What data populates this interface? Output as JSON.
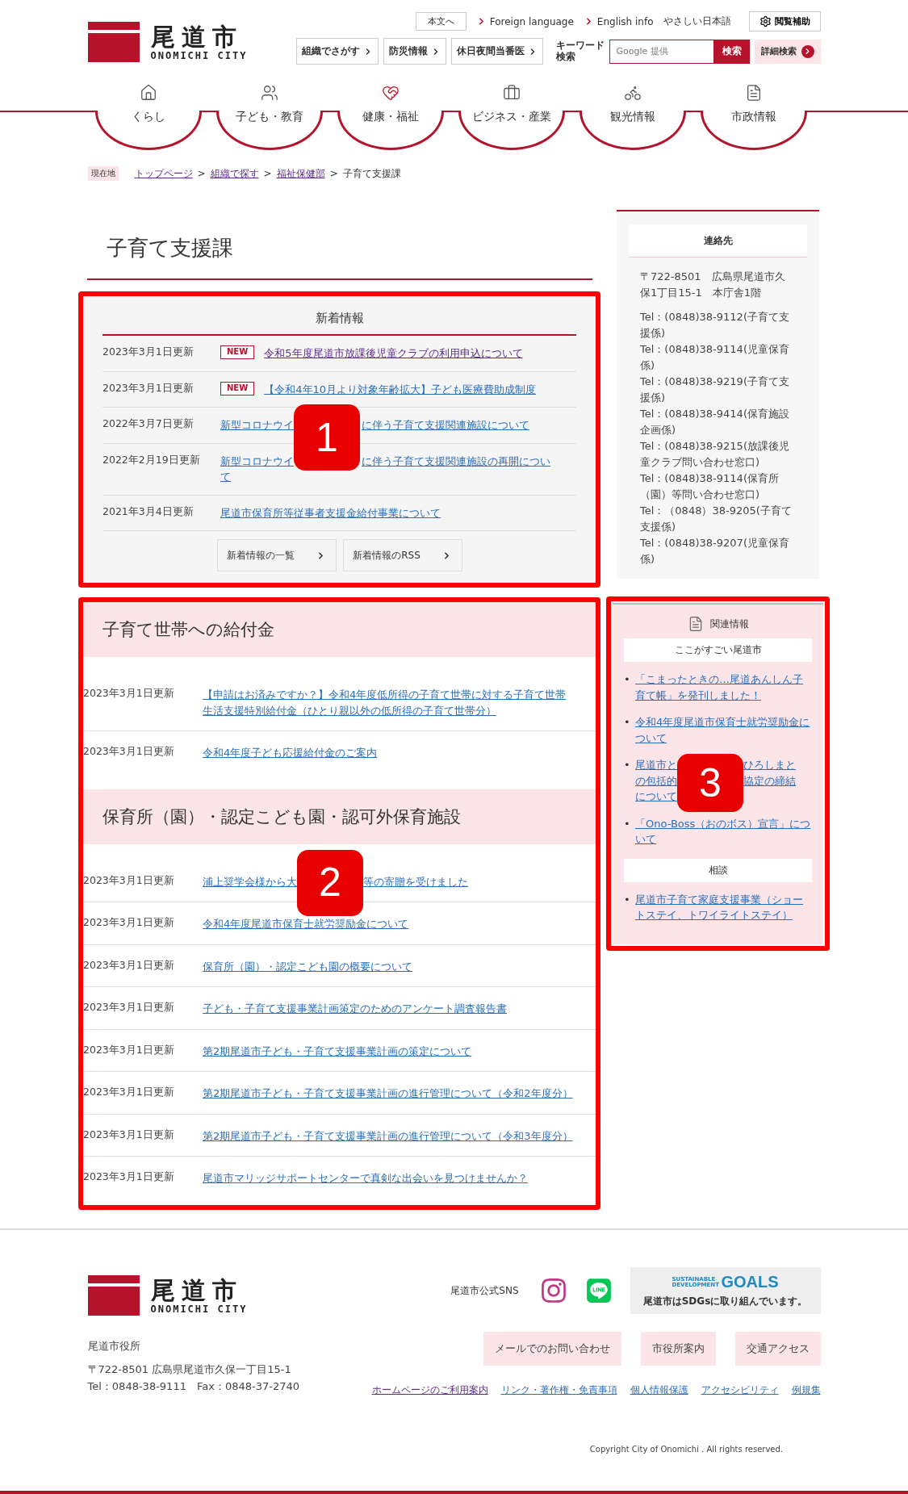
{
  "header": {
    "logo": {
      "name": "尾道市",
      "roman": "ONOMICHI CITY"
    },
    "top_links": [
      {
        "label": "本文へ",
        "kind": "boxed"
      },
      {
        "label": "Foreign language",
        "kind": "arrow"
      },
      {
        "label": "English info",
        "kind": "arrow"
      },
      {
        "label": "やさしい日本語",
        "kind": "plain"
      }
    ],
    "assist_button": "閲覧補助",
    "quick_buttons": [
      "組織でさがす",
      "防災情報",
      "休日夜間当番医"
    ],
    "search": {
      "label": "キーワード検索",
      "placeholder": "Google 提供",
      "button": "検索"
    },
    "advanced_search": "詳細検索"
  },
  "nav": [
    {
      "label": "くらし"
    },
    {
      "label": "子ども・教育"
    },
    {
      "label": "健康・福祉"
    },
    {
      "label": "ビジネス・産業"
    },
    {
      "label": "観光情報"
    },
    {
      "label": "市政情報"
    }
  ],
  "breadcrumb": {
    "tag": "現在地",
    "separator": ">",
    "items": [
      {
        "label": "トップページ",
        "kind": "link",
        "visited": true
      },
      {
        "label": "組織で探す",
        "kind": "link",
        "visited": true
      },
      {
        "label": "福祉保健部",
        "kind": "link",
        "visited": true
      },
      {
        "label": "子育て支援課",
        "kind": "current"
      }
    ]
  },
  "page_title": "子育て支援課",
  "news": {
    "title": "新着情報",
    "rows": [
      {
        "date": "2023年3月1日更新",
        "badge": "NEW",
        "link": {
          "text": "令和5年度尾道市放課後児童クラブの利用申込について",
          "visited": true
        }
      },
      {
        "date": "2023年3月1日更新",
        "badge": "NEW",
        "link": {
          "text": "【令和4年10月より対象年齢拡大】子ども医療費助成制度",
          "visited": false
        }
      },
      {
        "date": "2022年3月7日更新",
        "link": {
          "lines": [
            [
              "新型コロナウイ",
              "に伴う子育て支援関連施設について"
            ]
          ],
          "visited": false
        }
      },
      {
        "date": "2022年2月19日更新",
        "link": {
          "lines": [
            [
              "新型コロナウイ",
              "に伴う子育て支援関連施設の再開につい"
            ],
            [
              "て"
            ]
          ],
          "visited": false
        }
      },
      {
        "date": "2021年3月4日更新",
        "link": {
          "text": "尾道市保育所等従事者支援金給付事業について",
          "visited": false
        }
      }
    ],
    "buttons": [
      "新着情報の一覧",
      "新着情報のRSS"
    ]
  },
  "sections": [
    {
      "heading": "子育て世帯への給付金",
      "rows": [
        {
          "date": "2023年3月1日更新",
          "link": {
            "lines": [
              [
                "【申請はお済みですか？】令和4年度低所得の子育て世帯に対する子育て世帯"
              ],
              [
                "生活支援特別給付金（ひとり親以外の低所得の子育て世帯分）"
              ]
            ]
          }
        },
        {
          "date": "2023年3月1日更新",
          "link": {
            "text": "令和4年度子ども応援給付金のご案内"
          }
        }
      ]
    },
    {
      "heading": "保育所（園）・認定こども園・認可外保育施設",
      "rows": [
        {
          "date": "2023年3月1日更新",
          "link": {
            "lines": [
              [
                "浦上奨学会様から大",
                "等の寄贈を受けました"
              ]
            ]
          }
        },
        {
          "date": "2023年3月1日更新",
          "link": {
            "text": "令和4年度尾道市保育士就労奨励金について"
          }
        },
        {
          "date": "2023年3月1日更新",
          "link": {
            "text": "保育所（園）・認定こども園の概要について"
          }
        },
        {
          "date": "2023年3月1日更新",
          "link": {
            "text": "子ども・子育て支援事業計画策定のためのアンケート調査報告書"
          }
        },
        {
          "date": "2023年3月1日更新",
          "link": {
            "text": "第2期尾道市子ども・子育て支援事業計画の策定について"
          }
        },
        {
          "date": "2023年3月1日更新",
          "link": {
            "text": "第2期尾道市子ども・子育て支援事業計画の進行管理について（令和2年度分）"
          }
        },
        {
          "date": "2023年3月1日更新",
          "link": {
            "text": "第2期尾道市子ども・子育て支援事業計画の進行管理について（令和3年度分）"
          }
        },
        {
          "date": "2023年3月1日更新",
          "link": {
            "text": "尾道市マリッジサポートセンターで真剣な出会いを見つけませんか？"
          }
        }
      ]
    }
  ],
  "contact": {
    "title": "連絡先",
    "address": "〒722-8501　広島県尾道市久保1丁目15-1　本庁舎1階",
    "phones": [
      "Tel：(0848)38-9112(子育て支援係)",
      "Tel：(0848)38-9114(児童保育係)",
      "Tel：(0848)38-9219(子育て支援係)",
      "Tel：(0848)38-9414(保育施設企画係)",
      "Tel：(0848)38-9215(放課後児童クラブ問い合わせ窓口)",
      "Tel：(0848)38-9114(保育所（園）等問い合わせ窓口)",
      "Tel：（0848）38-9205(子育て支援係)",
      "Tel：(0848)38-9207(児童保育係)"
    ]
  },
  "related": {
    "title": "関連情報",
    "marker": "•",
    "groups": [
      {
        "heading": "ここがすごい尾道市",
        "links": [
          {
            "text": "「こまったときの…尾道あんしん子育て帳」を発刊しました！"
          },
          {
            "text": "令和4年度尾道市保育士就労奨励金について"
          },
          {
            "lines": [
              [
                "尾道市と",
                "ひろしまと"
              ],
              [
                "の包括的",
                "協定の締結"
              ],
              [
                "について"
              ]
            ]
          },
          {
            "text": "「Ono-Boss（おのボス）宣言」について"
          }
        ]
      },
      {
        "heading": "相談",
        "links": [
          {
            "text": "尾道市子育て家庭支援事業（ショートステイ、トワイライトステイ）"
          }
        ]
      }
    ]
  },
  "annotations": [
    {
      "label": "1"
    },
    {
      "label": "2"
    },
    {
      "label": "3"
    }
  ],
  "footer": {
    "logo": {
      "name": "尾道市",
      "roman": "ONOMICHI CITY"
    },
    "office": "尾道市役所",
    "address": "〒722-8501 広島県尾道市久保一丁目15-1",
    "tel": "Tel：0848-38-9111　Fax：0848-37-2740",
    "sns_label": "尾道市公式SNS",
    "sdgs": {
      "title_top": "SUSTAINABLE",
      "title_bottom": "DEVELOPMENT",
      "goals": "GOALS",
      "note": "尾道市はSDGsに取り組んでいます。"
    },
    "buttons": [
      "メールでのお問い合わせ",
      "市役所案内",
      "交通アクセス"
    ],
    "links": [
      {
        "label": "ホームページのご利用案内",
        "visited": true
      },
      {
        "label": "リンク・著作権・免責事項",
        "visited": false
      },
      {
        "label": "個人情報保護",
        "visited": false
      },
      {
        "label": "アクセシビリティ",
        "visited": false
      },
      {
        "label": "例規集",
        "visited": false
      }
    ],
    "copyright": "Copyright City of Onomichi . All rights reserved."
  }
}
